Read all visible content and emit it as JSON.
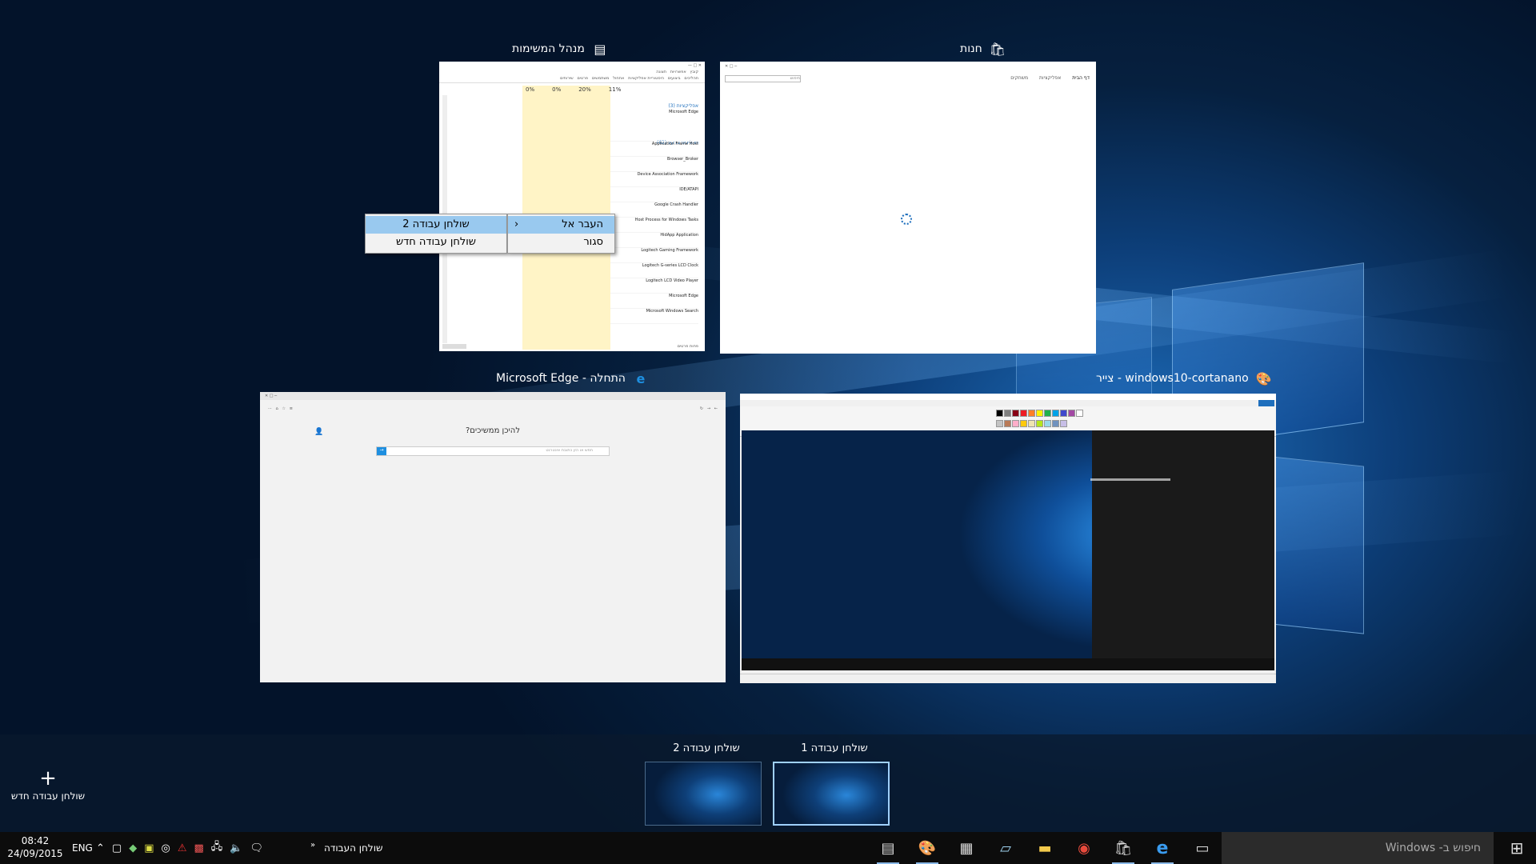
{
  "windows": {
    "task_manager": {
      "title": "מנהל המשימות",
      "icon": "task-manager-icon"
    },
    "store": {
      "title": "חנות",
      "icon": "store-icon"
    },
    "edge": {
      "title": "התחלה - Microsoft Edge",
      "icon": "edge-icon",
      "question": "להיכן ממשיכים?"
    },
    "paint": {
      "title": "windows10-cortanano - צייר",
      "icon": "paint-icon"
    }
  },
  "task_manager_content": {
    "columns": [
      "11%",
      "20%",
      "0%",
      "0%"
    ],
    "section_apps": "אפליקציות (3)",
    "section_bg": "תהליכים ברקע (62)",
    "rows": [
      "Microsoft Edge",
      "Application Frame Host",
      "Browser_Broker",
      "Device Association Framework",
      "IDE/ATAPI",
      "Google Crash Handler",
      "Host Process for Windows Tasks",
      "HidApp Application",
      "Logitech Gaming Framework",
      "Logitech G-series LCD Clock",
      "Logitech LCD Video Player",
      "Microsoft Edge",
      "Microsoft Windows Search"
    ],
    "footer": "פחות פרטים"
  },
  "store_content": {
    "tabs": [
      "דף הבית",
      "אפליקציות",
      "משחקים"
    ],
    "search_placeholder": "חיפוש"
  },
  "edge_content": {
    "search_placeholder": "חפש או הזן כתובת אינטרנט"
  },
  "context_menu": {
    "items": [
      {
        "label": "העבר אל",
        "has_submenu": true
      },
      {
        "label": "סגור",
        "has_submenu": false
      }
    ],
    "submenu": [
      {
        "label": "שולחן עבודה 2"
      },
      {
        "label": "שולחן עבודה חדש"
      }
    ]
  },
  "desktops": [
    {
      "label": "שולחן עבודה 1",
      "active": true
    },
    {
      "label": "שולחן עבודה 2",
      "active": false
    }
  ],
  "new_desktop": {
    "label": "שולחן עבודה חדש",
    "icon": "plus-icon"
  },
  "taskbar": {
    "search_placeholder": "חיפוש ב- Windows",
    "task_view_icon": "task-view-icon",
    "start_icon": "windows-start-icon",
    "pinned": [
      "edge-icon",
      "store-icon",
      "chrome-icon",
      "file-explorer-icon",
      "notepad-icon",
      "calculator-icon",
      "paint-icon",
      "task-manager-icon"
    ],
    "desktop_toolbar": "שולחן העבודה",
    "clock_time": "08:42",
    "clock_date": "24/09/2015",
    "lang": "ENG"
  },
  "colors": {
    "accent": "#99c9ef",
    "taskbar": "#0c0c0c"
  }
}
